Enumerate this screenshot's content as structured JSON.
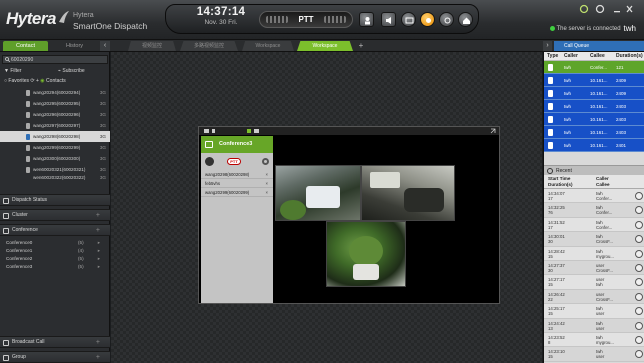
{
  "app": {
    "brand": "Hytera",
    "product_line1": "Hytera",
    "product_line2": "SmartOne Dispatch",
    "time": "14:37:14",
    "date": "Nov. 30 Fri.",
    "ptt_label": "PTT",
    "status_text": "The server is connected",
    "user": "twh"
  },
  "left_tabs": {
    "contact": "Contact",
    "history": "History"
  },
  "workspace_tabs": [
    {
      "label": "视频监控",
      "active": false
    },
    {
      "label": "多路视频监控",
      "active": false
    },
    {
      "label": "Workspace",
      "active": false
    },
    {
      "label": "Workspace",
      "active": true
    }
  ],
  "sidebar": {
    "search_value": "60020290",
    "filter_label": "Filter",
    "subscribe_label": "Subscribe",
    "favorites_label": "Favorites",
    "contacts_label": "Contacts",
    "contacts": [
      {
        "name": "wang20294(60020294)",
        "tag": "3G"
      },
      {
        "name": "wang20295(60020295)",
        "tag": "3G"
      },
      {
        "name": "wang20296(60020296)",
        "tag": "3G"
      },
      {
        "name": "wang20297(60020297)",
        "tag": "3G"
      },
      {
        "name": "wang20298(60020298)",
        "tag": "3G"
      },
      {
        "name": "wang20299(60020299)",
        "tag": "3G"
      },
      {
        "name": "wang20300(60020300)",
        "tag": "3G"
      },
      {
        "name": "wen60020321(60020321)",
        "tag": "3G"
      },
      {
        "name": "wen60020322(60020322)",
        "tag": "3G"
      }
    ],
    "dispatch_status": "Dispatch Status",
    "cluster": "Cluster",
    "conference": "Conference",
    "conferences": [
      {
        "name": "Conference0",
        "count": "(5)"
      },
      {
        "name": "Conference1",
        "count": "(4)"
      },
      {
        "name": "Conference2",
        "count": "(5)"
      },
      {
        "name": "Conference3",
        "count": "(5)"
      }
    ],
    "broadcast": "Broadcast Call",
    "more": "Group"
  },
  "conference_window": {
    "title": "Conference3",
    "ptt_short": "PTT",
    "members": [
      {
        "name": "wang20298(60020298)"
      },
      {
        "name": "feb5vhs"
      },
      {
        "name": "wang20299(60020299)"
      }
    ]
  },
  "call_queue": {
    "title": "Call Queue",
    "headers": {
      "type": "Type",
      "caller": "Caller",
      "callee": "Callee",
      "duration": "Duration(s)"
    },
    "rows": [
      {
        "caller": "twh",
        "callee": "Confer...",
        "duration": "121",
        "highlight": true
      },
      {
        "caller": "twh",
        "callee": "10.161...",
        "duration": "2409",
        "highlight": false
      },
      {
        "caller": "twh",
        "callee": "10.161...",
        "duration": "2409",
        "highlight": false
      },
      {
        "caller": "twh",
        "callee": "10.161...",
        "duration": "2403",
        "highlight": false
      },
      {
        "caller": "twh",
        "callee": "10.161...",
        "duration": "2403",
        "highlight": false
      },
      {
        "caller": "twh",
        "callee": "10.161...",
        "duration": "2403",
        "highlight": false
      },
      {
        "caller": "twh",
        "callee": "10.161...",
        "duration": "2401",
        "highlight": false
      }
    ]
  },
  "recent": {
    "title": "Recent",
    "header_start": "Start Time",
    "header_duration": "Duration(s)",
    "header_caller": "Caller",
    "header_callee": "Callee",
    "rows": [
      {
        "time": "14:34:07",
        "dur": "17",
        "caller": "twh",
        "callee": "Confer..."
      },
      {
        "time": "14:32:25",
        "dur": "76",
        "caller": "twh",
        "callee": "Confer..."
      },
      {
        "time": "14:31:52",
        "dur": "17",
        "caller": "twh",
        "callee": "Confer..."
      },
      {
        "time": "14:30:01",
        "dur": "30",
        "caller": "twh",
        "callee": "CrossF..."
      },
      {
        "time": "14:28:42",
        "dur": "15",
        "caller": "twh",
        "callee": "mygrou..."
      },
      {
        "time": "14:27:37",
        "dur": "30",
        "caller": "user",
        "callee": "CrossF..."
      },
      {
        "time": "14:27:17",
        "dur": "15",
        "caller": "user",
        "callee": "twh"
      },
      {
        "time": "14:26:42",
        "dur": "22",
        "caller": "user",
        "callee": "CrossF..."
      },
      {
        "time": "14:25:17",
        "dur": "15",
        "caller": "twh",
        "callee": "user"
      },
      {
        "time": "14:24:42",
        "dur": "13",
        "caller": "twh",
        "callee": "user"
      },
      {
        "time": "14:23:52",
        "dur": "8",
        "caller": "twh",
        "callee": "mygrou..."
      },
      {
        "time": "14:23:10",
        "dur": "15",
        "caller": "twh",
        "callee": "user"
      }
    ]
  },
  "colors": {
    "accent_green": "#67a627",
    "queue_blue": "#1750c7",
    "tab_green": "#7cbf2c"
  }
}
